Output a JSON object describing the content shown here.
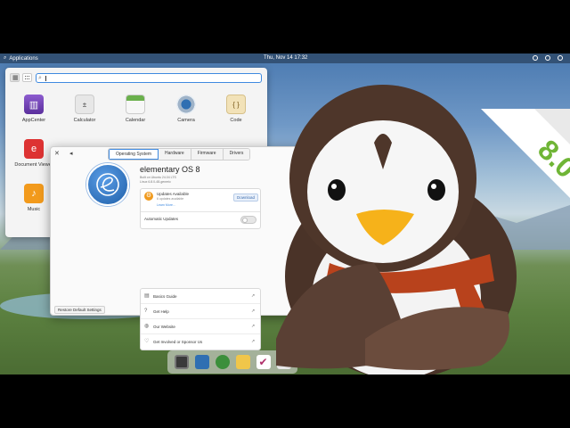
{
  "top_panel": {
    "applications_label": "Applications",
    "clock": "Thu, Nov 14   17:32"
  },
  "app_menu": {
    "apps": [
      {
        "label": "AppCenter",
        "icon": "appcenter-icon"
      },
      {
        "label": "Calculator",
        "icon": "calculator-icon"
      },
      {
        "label": "Calendar",
        "icon": "calendar-icon"
      },
      {
        "label": "Camera",
        "icon": "camera-icon"
      },
      {
        "label": "Code",
        "icon": "code-icon"
      },
      {
        "label": "Document Viewer",
        "icon": "document-viewer-icon"
      },
      {
        "label": "Music",
        "icon": "music-icon"
      }
    ]
  },
  "settings": {
    "tabs": [
      "Operating System",
      "Hardware",
      "Firmware",
      "Drivers"
    ],
    "active_tab": "Operating System",
    "os_name": "elementary OS 8",
    "build_line1": "Built on Ubuntu 24.04 LTS",
    "build_line2": "Linux 6.8.0-48-generic",
    "updates_title": "Updates Available",
    "updates_sub": "6 updates available",
    "learn_more": "Learn More…",
    "download_label": "Download",
    "auto_updates_label": "Automatic Updates",
    "auto_updates_on": false,
    "links": [
      "Basics Guide",
      "Get Help",
      "Our Website",
      "Get Involved or Sponsor Us"
    ],
    "restore_label": "Restore Default Settings"
  },
  "badge": {
    "text": "8.0"
  },
  "colors": {
    "accent": "#3f8ae0",
    "update_orange": "#f09a1e",
    "badge_green": "#6fb536"
  }
}
